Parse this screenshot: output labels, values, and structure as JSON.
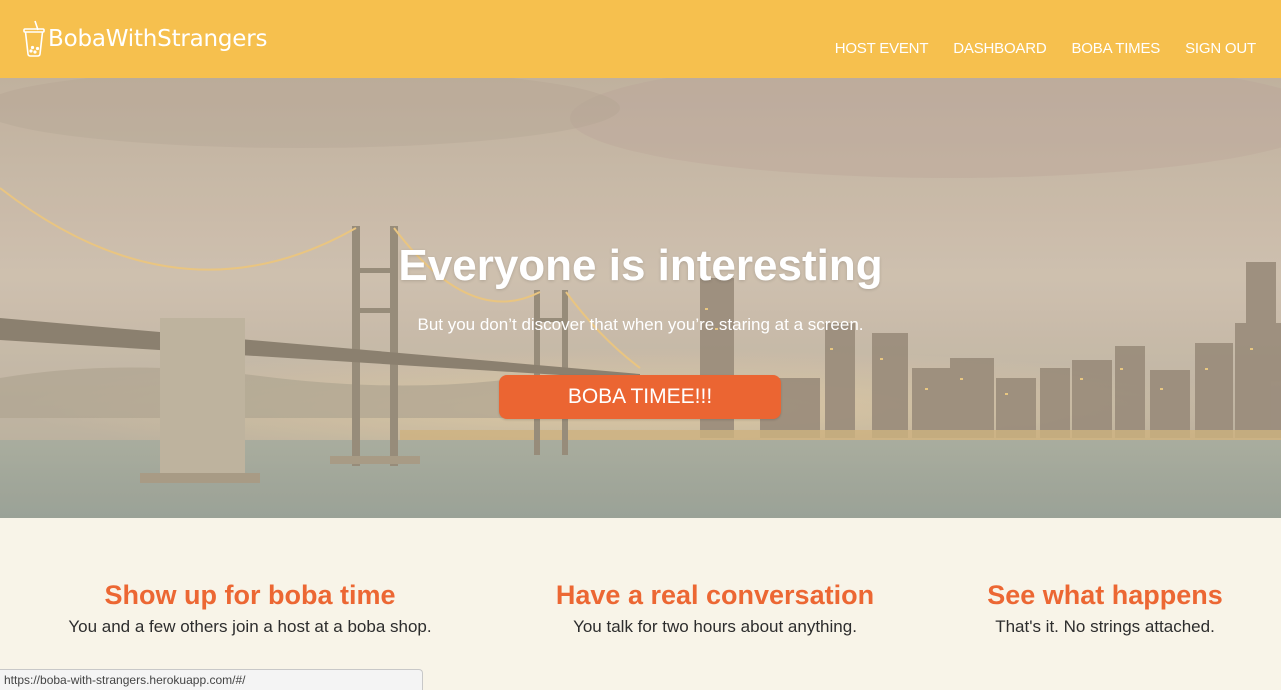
{
  "brand": {
    "name": "BobaWithStrangers",
    "icon": "boba-cup-icon"
  },
  "nav": {
    "host_event": "HOST EVENT",
    "dashboard": "DASHBOARD",
    "boba_times": "BOBA TIMES",
    "sign_out": "SIGN OUT"
  },
  "hero": {
    "title": "Everyone is interesting",
    "subtitle": "But you don’t discover that when you’re staring at a screen.",
    "cta": "BOBA TIMEE!!!"
  },
  "features": [
    {
      "title": "Show up for boba time",
      "text": "You and a few others join a host at a boba shop."
    },
    {
      "title": "Have a real conversation",
      "text": "You talk for two hours about anything."
    },
    {
      "title": "See what happens",
      "text": "That's it. No strings attached."
    }
  ],
  "status_bar": {
    "url": "https://boba-with-strangers.herokuapp.com/#/"
  },
  "colors": {
    "navbar": "#f6c04e",
    "accent": "#eb6532",
    "feature_title": "#ec6733",
    "page_bg": "#f8f4e8"
  }
}
